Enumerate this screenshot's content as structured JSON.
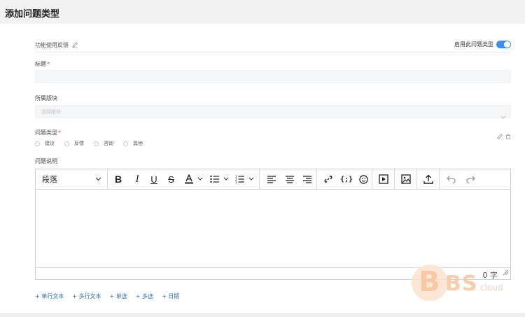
{
  "page": {
    "title": "添加问题类型"
  },
  "header": {
    "section_label": "功能使用反馈",
    "enable_label": "启用此问题类型",
    "enabled": true
  },
  "form": {
    "title_label": "标题",
    "title_value": "",
    "module_label": "所属版块",
    "module_placeholder": "选择版块",
    "qtype_label": "问题类型",
    "qtype_options": [
      "建议",
      "反馈",
      "咨询",
      "其他"
    ],
    "desc_label": "问题说明"
  },
  "editor": {
    "paragraph_select": "段落",
    "word_count": "0 字",
    "toolbar_icons": [
      "bold-icon",
      "italic-icon",
      "underline-icon",
      "strikethrough-icon",
      "font-color-icon",
      "bullet-list-icon",
      "numbered-list-icon",
      "align-left-icon",
      "align-center-icon",
      "align-right-icon",
      "link-icon",
      "code-icon",
      "emoji-icon",
      "video-icon",
      "image-icon",
      "upload-icon",
      "undo-icon",
      "redo-icon"
    ]
  },
  "add_fields": [
    "+ 单行文本",
    "+ 多行文本",
    "+ 单选",
    "+ 多选",
    "+ 日期"
  ],
  "watermark": {
    "text": "BBS cloud"
  },
  "colors": {
    "accent": "#3e8ef7",
    "link": "#2f6fb7",
    "required": "#e54848"
  }
}
